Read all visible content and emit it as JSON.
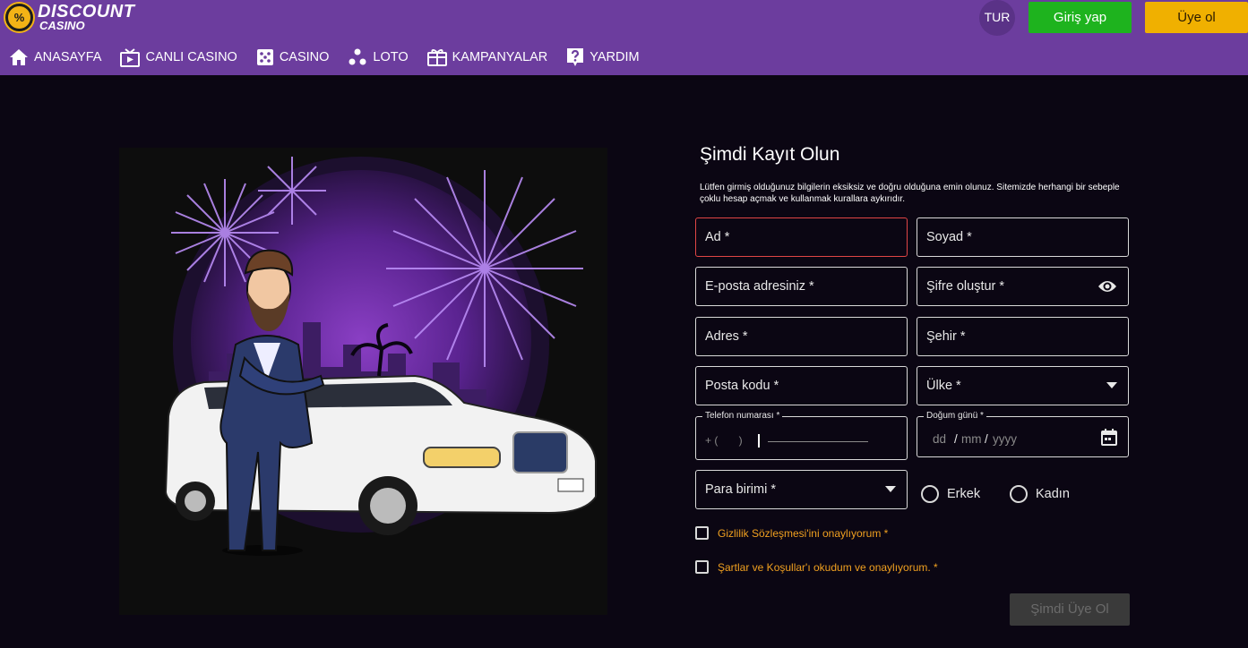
{
  "brand": {
    "logo_top": "DISCOUNT",
    "logo_bottom": "CASINO",
    "logo_coin": "%"
  },
  "header": {
    "language": "TUR",
    "login_label": "Giriş yap",
    "register_label": "Üye ol"
  },
  "nav": [
    {
      "label": "ANASAYFA",
      "icon": "home-icon"
    },
    {
      "label": "CANLI CASINO",
      "icon": "tv-icon"
    },
    {
      "label": "CASINO",
      "icon": "dice-icon"
    },
    {
      "label": "LOTO",
      "icon": "balls-icon"
    },
    {
      "label": "KAMPANYALAR",
      "icon": "gift-icon"
    },
    {
      "label": "YARDIM",
      "icon": "help-icon"
    }
  ],
  "form": {
    "title": "Şimdi Kayıt Olun",
    "note": "Lütfen girmiş olduğunuz bilgilerin eksiksiz ve doğru olduğuna emin olunuz. Sitemizde herhangi bir sebeple çoklu hesap açmak ve kullanmak kurallara aykırıdır.",
    "first_name": "Ad *",
    "last_name": "Soyad *",
    "email": "E-posta adresiniz *",
    "password": "Şifre oluştur *",
    "address": "Adres *",
    "city": "Şehir *",
    "postal_code": "Posta kodu *",
    "country": "Ülke *",
    "phone_label": "Telefon numarası *",
    "phone_mask": "+ (       )",
    "birth_label": "Doğum günü *",
    "birth_dd": "dd",
    "birth_mm": "mm",
    "birth_yyyy": "yyyy",
    "currency": "Para birimi *",
    "gender_male": "Erkek",
    "gender_female": "Kadın",
    "privacy_consent": "Gizlilik Sözleşmesi'ini onaylıyorum *",
    "terms_consent": "Şartlar ve Koşullar'ı okudum ve onaylıyorum. *",
    "submit_label": "Şimdi Üye Ol"
  },
  "colors": {
    "header_bg": "#6c3d9e",
    "page_bg": "#0b0613",
    "login_btn": "#1eb31e",
    "register_btn": "#f0b000",
    "error_border": "#e04545",
    "consent_text": "#f0a020"
  }
}
